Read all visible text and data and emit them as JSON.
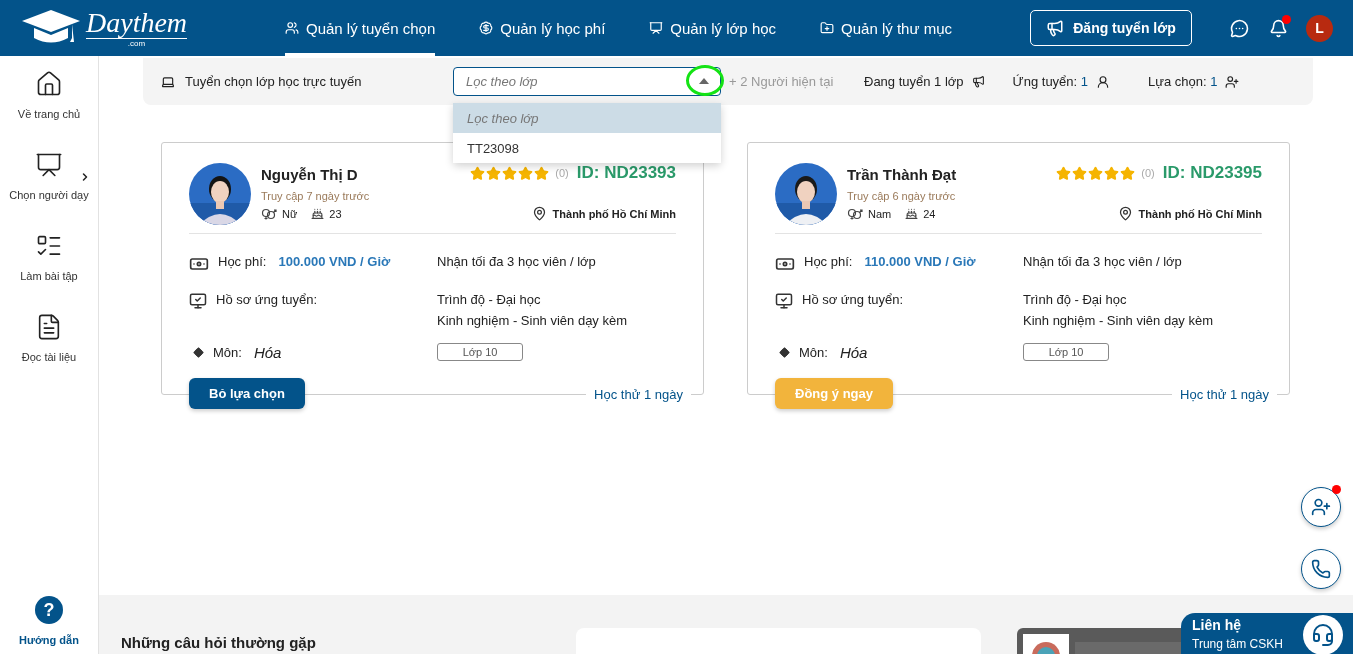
{
  "header": {
    "logo": {
      "name": "Daythem",
      "suffix": ".com"
    },
    "nav": [
      {
        "label": "Quản lý tuyển chọn",
        "selected": true
      },
      {
        "label": "Quản lý học phí",
        "selected": false
      },
      {
        "label": "Quản lý lớp học",
        "selected": false
      },
      {
        "label": "Quản lý thư mục",
        "selected": false
      }
    ],
    "post_button": "Đăng tuyển lớp",
    "notifications_unread": true,
    "avatar": "L"
  },
  "sidebar": {
    "items": [
      {
        "label": "Về trang chủ",
        "has_submenu": false
      },
      {
        "label": "Chọn người dạy",
        "has_submenu": true
      },
      {
        "label": "Làm bài tập",
        "has_submenu": false
      },
      {
        "label": "Đọc tài liệu",
        "has_submenu": false
      }
    ],
    "guide": {
      "icon": "?",
      "label": "Hướng dẫn"
    }
  },
  "filter_bar": {
    "title": "Tuyển chọn lớp học trực tuyến",
    "select": {
      "placeholder": "Lọc theo lớp",
      "expanded": true,
      "caret_highlighted": true,
      "options": [
        {
          "label": "Lọc theo lớp",
          "selected": true
        },
        {
          "label": "TT23098",
          "selected": false
        }
      ]
    },
    "current": "+ 2 Người hiện tại",
    "recruiting": "Đang tuyển 1 lớp",
    "applied_label": "Ứng tuyển:",
    "applied": "1",
    "chosen_label": "Lựa chọn:",
    "chosen": "1"
  },
  "cards": [
    {
      "name": "Nguyễn Thị D",
      "last_access": "Truy cập 7 ngày trước",
      "gender": "Nữ",
      "age": "23",
      "stars": 5,
      "rating_count": "(0)",
      "id": "ID: ND23393",
      "location": "Thành phố Hồ Chí Minh",
      "fee_label": "Học phí:",
      "fee": "100.000 VND / Giờ",
      "capacity": "Nhận tối đa 3 học viên / lớp",
      "profile_label": "Hồ sơ ứng tuyển:",
      "level": "Trình độ - Đại học",
      "experience": "Kinh nghiệm - Sinh viên dạy kèm",
      "subject_label": "Môn:",
      "subject": "Hóa",
      "grade": "Lớp 10",
      "action": {
        "label": "Bỏ lựa chọn",
        "kind": "deselect"
      },
      "trial": "Học thử 1 ngày"
    },
    {
      "name": "Trần Thành Đạt",
      "last_access": "Truy cập 6 ngày trước",
      "gender": "Nam",
      "age": "24",
      "stars": 5,
      "rating_count": "(0)",
      "id": "ID: ND23395",
      "location": "Thành phố Hồ Chí Minh",
      "fee_label": "Học phí:",
      "fee": "110.000 VND / Giờ",
      "capacity": "Nhận tối đa 3 học viên / lớp",
      "profile_label": "Hồ sơ ứng tuyển:",
      "level": "Trình độ - Đại học",
      "experience": "Kinh nghiệm - Sinh viên dạy kèm",
      "subject_label": "Môn:",
      "subject": "Hóa",
      "grade": "Lớp 10",
      "action": {
        "label": "Đồng ý ngay",
        "kind": "accept"
      },
      "trial": "Học thử 1 ngày"
    }
  ],
  "floating": {
    "invite_unread": true
  },
  "footer": {
    "faq_title": "Những câu hỏi thường gặp"
  },
  "contact": {
    "title": "Liên hệ",
    "subtitle": "Trung tâm CSKH"
  }
}
